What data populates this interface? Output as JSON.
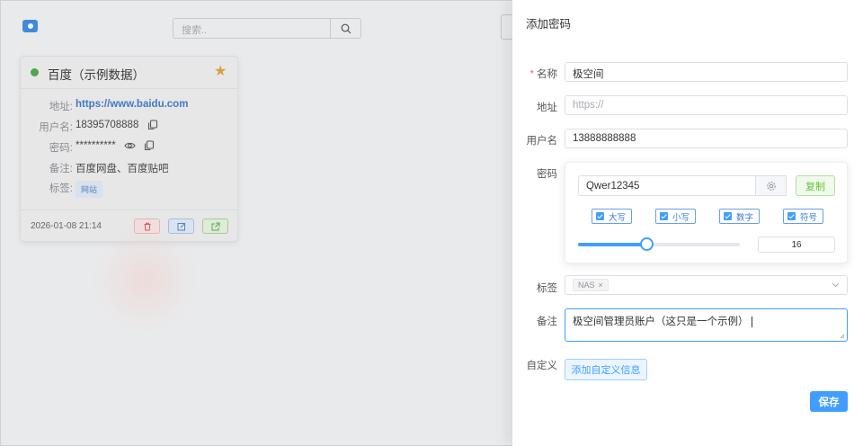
{
  "search": {
    "placeholder": "搜索.."
  },
  "card": {
    "title": "百度（示例数据）",
    "fields": [
      {
        "key": "地址:",
        "value": "https://www.baidu.com"
      },
      {
        "key": "用户名:",
        "value": "18395708888"
      },
      {
        "key": "密码:",
        "value": "**********"
      },
      {
        "key": "备注:",
        "value": "百度网盘、百度贴吧"
      },
      {
        "key": "标签:",
        "value": "网站"
      }
    ],
    "date": "2026-01-08 21:14"
  },
  "drawer": {
    "title": "添加密码",
    "name_label": "名称",
    "name_value": "极空间",
    "url_label": "地址",
    "url_placeholder": "https://",
    "user_label": "用户名",
    "user_value": "13888888888",
    "password_label": "密码",
    "password_value": "Qwer12345",
    "copy_label": "复制",
    "options": [
      {
        "label": "大写",
        "checked": true
      },
      {
        "label": "小写",
        "checked": true
      },
      {
        "label": "数字",
        "checked": true
      },
      {
        "label": "符号",
        "checked": true
      }
    ],
    "length": "16",
    "length_fraction": 0.42,
    "tag_label": "标签",
    "tag_chip": "NAS",
    "note_label": "备注",
    "note_value": "极空间管理员账户（这只是一个示例）",
    "custom_label": "自定义",
    "add_custom_label": "添加自定义信息",
    "save_label": "保存"
  },
  "colors": {
    "primary": "#409eff",
    "success": "#67c23a",
    "danger": "#f56c6c",
    "star": "#e6a23c",
    "online_dot": "#52a84a"
  }
}
